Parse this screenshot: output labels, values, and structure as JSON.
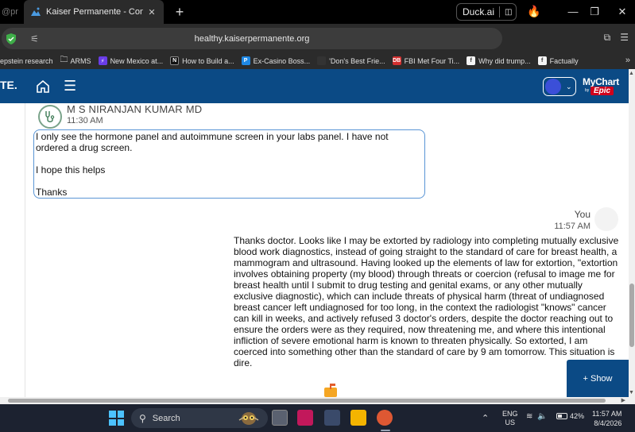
{
  "browser": {
    "prev_tab_title": "@pr",
    "active_tab_title": "Kaiser Permanente - Conversa",
    "duck_ai_label": "Duck.ai",
    "url": "healthy.kaiserpermanente.org"
  },
  "bookmarks": [
    {
      "label": "epstein research",
      "icon": "none",
      "color": ""
    },
    {
      "label": "ARMS",
      "icon": "folder-icon",
      "color": "#e0e0e0"
    },
    {
      "label": "New Mexico at...",
      "icon": "bolt-icon",
      "color": "#6a3de8"
    },
    {
      "label": "How to Build a...",
      "icon": "n-icon",
      "color": "#111111"
    },
    {
      "label": "Ex-Casino Boss...",
      "icon": "p-icon",
      "color": "#1e88e5"
    },
    {
      "label": "'Don's Best Frie...",
      "icon": "dark-icon",
      "color": "#333333"
    },
    {
      "label": "FBI Met Four Ti...",
      "icon": "db-icon",
      "color": "#d32f2f"
    },
    {
      "label": "Why did trump...",
      "icon": "f-icon",
      "color": "#f5f5f5"
    },
    {
      "label": "Factually",
      "icon": "f-icon",
      "color": "#f5f5f5"
    }
  ],
  "header": {
    "logo_fragment": "TE.",
    "mychart_label": "MyChart",
    "epic_label": "Epic",
    "epic_prefix": "by"
  },
  "conversation": {
    "sender_name": "M S NIRANJAN KUMAR MD",
    "sender_time": "11:30 AM",
    "incoming_paragraphs": [
      "I only see the hormone panel and autoimmune screen in your labs panel. I have not ordered a drug screen.",
      "I hope this helps",
      "Thanks"
    ],
    "you_label": "You",
    "you_time": "11:57 AM",
    "outgoing_message": "Thanks doctor. Looks like I may be extorted by radiology into completing mutually exclusive blood work diagnostics, instead of going straight to the standard of care for breast health, a mammogram and ultrasound. Having looked up the elements of law for extortion, \"extortion involves obtaining property (my blood) through threats or coercion (refusal to image me for breast health until I submit to drug testing and genital exams, or any other mutually exclusive diagnostic), which can include threats of physical harm (threat of undiagnosed breast cancer left undiagnosed for too long, in the context the radiologist \"knows\" cancer can kill in weeks, and actively refused 3 doctor's orders, despite the doctor reaching out to ensure the orders were as they required, now threatening me, and where this intentional infliction of severe emotional harm is known to threaten physically. So extorted, I am coerced into something other than the standard of care by 9 am tomorrow. This situation is dire.",
    "show_button": "+ Show"
  },
  "taskbar": {
    "search_label": "Search",
    "lang_line1": "ENG",
    "lang_line2": "US",
    "battery": "42%",
    "time": "11:57 AM",
    "date": "8/4/2026"
  },
  "colors": {
    "header_blue": "#0b4a85",
    "bubble_border": "#5a95d5",
    "taskbar_bg": "#1c2230"
  }
}
